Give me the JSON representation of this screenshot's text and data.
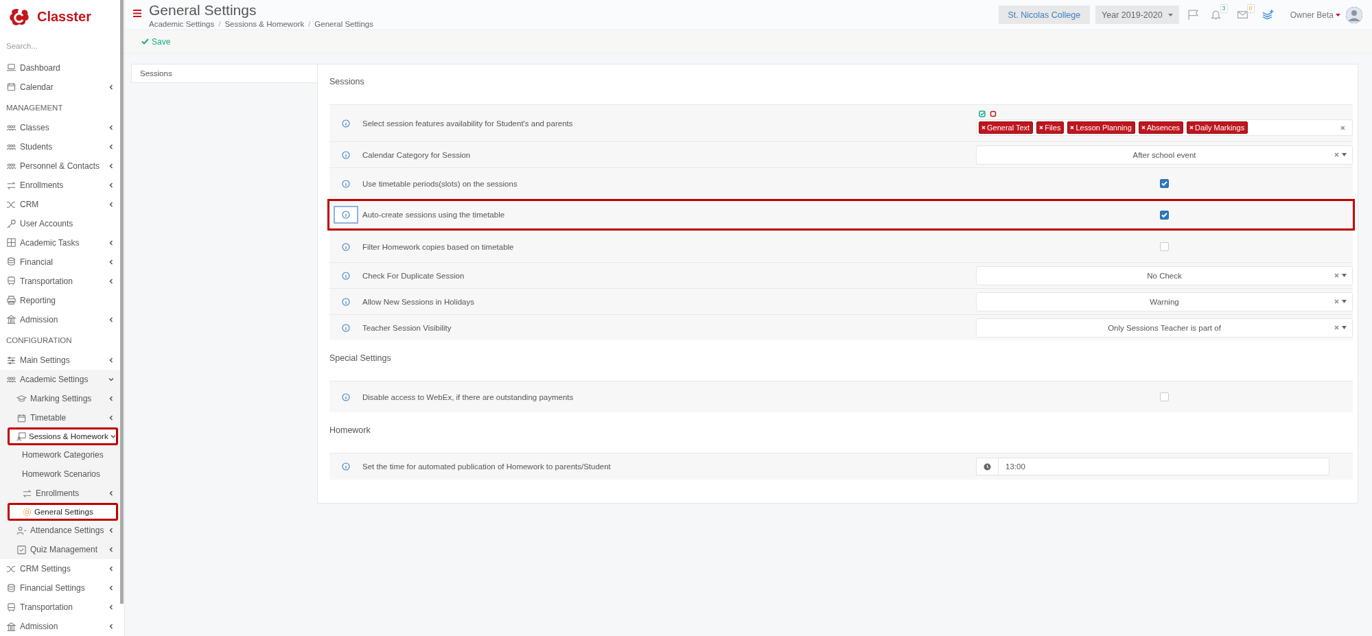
{
  "brand": {
    "name": "Classter"
  },
  "sidebar": {
    "search": {
      "placeholder": "Search..."
    },
    "nav": [
      {
        "kind": "item",
        "label": "Dashboard",
        "collapsible": false,
        "expanded": false,
        "selected": false,
        "highlighted": false
      },
      {
        "kind": "item",
        "label": "Calendar",
        "collapsible": true,
        "expanded": false,
        "selected": false,
        "highlighted": false
      },
      {
        "kind": "heading",
        "label": "MANAGEMENT"
      },
      {
        "kind": "item",
        "label": "Classes",
        "collapsible": true,
        "expanded": false,
        "selected": false,
        "highlighted": false
      },
      {
        "kind": "item",
        "label": "Students",
        "collapsible": true,
        "expanded": false,
        "selected": false,
        "highlighted": false
      },
      {
        "kind": "item",
        "label": "Personnel & Contacts",
        "collapsible": true,
        "expanded": false,
        "selected": false,
        "highlighted": false
      },
      {
        "kind": "item",
        "label": "Enrollments",
        "collapsible": true,
        "expanded": false,
        "selected": false,
        "highlighted": false
      },
      {
        "kind": "item",
        "label": "CRM",
        "collapsible": true,
        "expanded": false,
        "selected": false,
        "highlighted": false
      },
      {
        "kind": "item",
        "label": "User Accounts",
        "collapsible": false,
        "expanded": false,
        "selected": false,
        "highlighted": false
      },
      {
        "kind": "item",
        "label": "Academic Tasks",
        "collapsible": true,
        "expanded": false,
        "selected": false,
        "highlighted": false
      },
      {
        "kind": "item",
        "label": "Financial",
        "collapsible": true,
        "expanded": false,
        "selected": false,
        "highlighted": false
      },
      {
        "kind": "item",
        "label": "Transportation",
        "collapsible": true,
        "expanded": false,
        "selected": false,
        "highlighted": false
      },
      {
        "kind": "item",
        "label": "Reporting",
        "collapsible": false,
        "expanded": false,
        "selected": false,
        "highlighted": false
      },
      {
        "kind": "item",
        "label": "Admission",
        "collapsible": true,
        "expanded": false,
        "selected": false,
        "highlighted": false
      },
      {
        "kind": "heading",
        "label": "CONFIGURATION"
      },
      {
        "kind": "item",
        "label": "Main Settings",
        "collapsible": true,
        "expanded": false,
        "selected": false,
        "highlighted": false
      },
      {
        "kind": "item",
        "label": "Academic Settings",
        "collapsible": true,
        "expanded": true,
        "selected": false,
        "highlighted": false,
        "children": [
          {
            "kind": "item",
            "label": "Marking Settings",
            "collapsible": true,
            "expanded": false,
            "selected": false,
            "highlighted": false
          },
          {
            "kind": "item",
            "label": "Timetable",
            "collapsible": true,
            "expanded": false,
            "selected": false,
            "highlighted": false
          },
          {
            "kind": "item",
            "label": "Sessions & Homework",
            "collapsible": true,
            "expanded": true,
            "selected": true,
            "highlighted": true,
            "children": [
              {
                "kind": "item",
                "label": "Homework Categories",
                "collapsible": false,
                "expanded": false,
                "selected": false,
                "highlighted": false
              },
              {
                "kind": "item",
                "label": "Homework Scenarios",
                "collapsible": false,
                "expanded": false,
                "selected": false,
                "highlighted": false
              },
              {
                "kind": "item",
                "label": "Enrollments",
                "collapsible": true,
                "expanded": false,
                "selected": false,
                "highlighted": false
              },
              {
                "kind": "item",
                "label": "General Settings",
                "collapsible": false,
                "expanded": false,
                "selected": true,
                "highlighted": true
              }
            ]
          },
          {
            "kind": "item",
            "label": "Attendance Settings",
            "collapsible": true,
            "expanded": false,
            "selected": false,
            "highlighted": false
          },
          {
            "kind": "item",
            "label": "Quiz Management",
            "collapsible": true,
            "expanded": false,
            "selected": false,
            "highlighted": false
          }
        ]
      },
      {
        "kind": "item",
        "label": "CRM Settings",
        "collapsible": true,
        "expanded": false,
        "selected": false,
        "highlighted": false
      },
      {
        "kind": "item",
        "label": "Financial Settings",
        "collapsible": true,
        "expanded": false,
        "selected": false,
        "highlighted": false
      },
      {
        "kind": "item",
        "label": "Transportation",
        "collapsible": true,
        "expanded": false,
        "selected": false,
        "highlighted": false
      },
      {
        "kind": "item",
        "label": "Admission",
        "collapsible": true,
        "expanded": false,
        "selected": false,
        "highlighted": false
      }
    ]
  },
  "header": {
    "title": "General Settings",
    "breadcrumb": [
      "Academic Settings",
      "Sessions & Homework",
      "General Settings"
    ],
    "separator": "/",
    "school": "St. Nicolas College",
    "year": "Year 2019-2020",
    "notifications": {
      "badge": "3"
    },
    "messages": {
      "badge": "0"
    },
    "user": "Owner Beta"
  },
  "toolbar": {
    "save": "Save"
  },
  "tabs": [
    {
      "label": "Sessions",
      "selected": true
    }
  ],
  "sections": [
    {
      "title": "Sessions",
      "rows": [
        {
          "kind": "tags",
          "label": "Select session features availability for Student's and parents",
          "highlighted": false,
          "info_focused": false,
          "tags": [
            "General Text",
            "Files",
            "Lesson Planning",
            "Absences",
            "Daily Markings"
          ]
        },
        {
          "kind": "select",
          "label": "Calendar Category for Session",
          "highlighted": false,
          "info_focused": false,
          "value": "After school event"
        },
        {
          "kind": "checkbox",
          "label": "Use timetable periods(slots) on the sessions",
          "highlighted": false,
          "info_focused": false,
          "checked": true
        },
        {
          "kind": "checkbox",
          "label": "Auto-create sessions using the timetable",
          "highlighted": true,
          "info_focused": true,
          "checked": true
        },
        {
          "kind": "checkbox",
          "label": "Filter Homework copies based on timetable",
          "highlighted": false,
          "info_focused": false,
          "checked": false
        },
        {
          "kind": "select",
          "label": "Check For Duplicate Session",
          "highlighted": false,
          "info_focused": false,
          "value": "No Check"
        },
        {
          "kind": "select",
          "label": "Allow New Sessions in Holidays",
          "highlighted": false,
          "info_focused": false,
          "value": "Warning"
        },
        {
          "kind": "select",
          "label": "Teacher Session Visibility",
          "highlighted": false,
          "info_focused": false,
          "value": "Only Sessions Teacher is part of"
        }
      ]
    },
    {
      "title": "Special Settings",
      "rows": [
        {
          "kind": "checkbox",
          "label": "Disable access to WebEx, if there are outstanding payments",
          "highlighted": false,
          "info_focused": false,
          "checked": false
        }
      ]
    },
    {
      "title": "Homework",
      "rows": [
        {
          "kind": "time",
          "label": "Set the time for automated publication of Homework to parents/Student",
          "highlighted": false,
          "info_focused": false,
          "value": "13:00"
        }
      ]
    }
  ]
}
